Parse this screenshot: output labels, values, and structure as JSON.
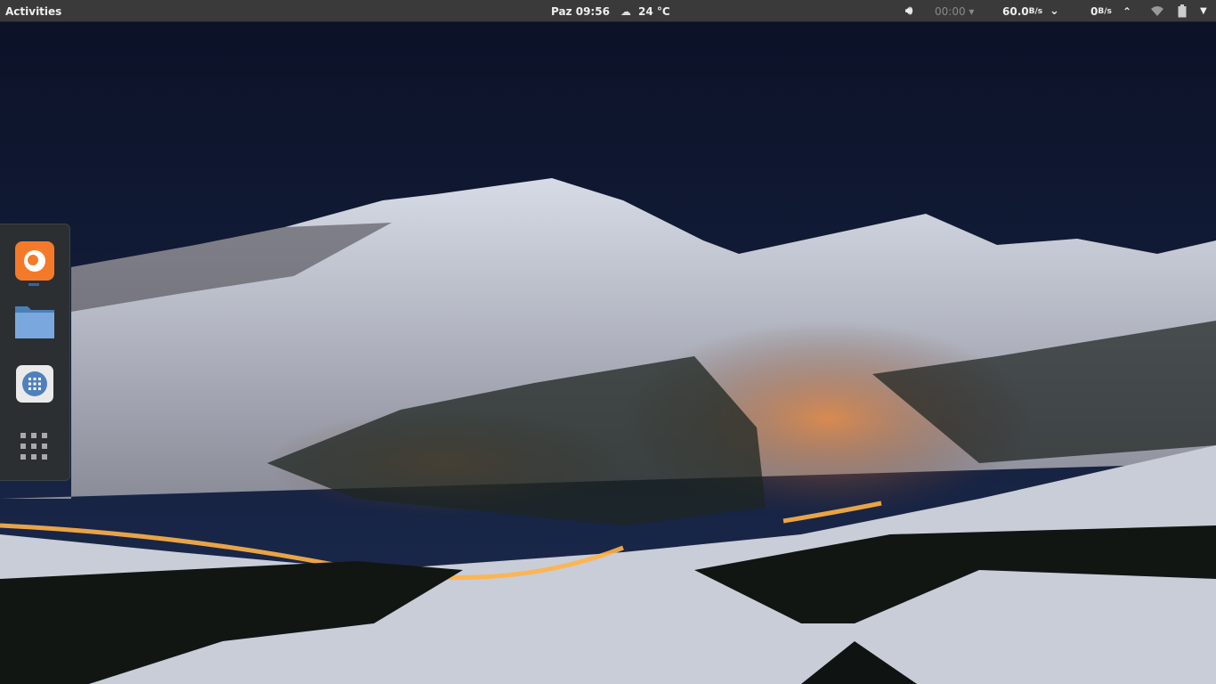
{
  "topbar": {
    "activities": "Activities",
    "clock": "Paz 09:56",
    "weather_icon": "cloud-icon",
    "temperature": "24 °C",
    "volume_icon": "speaker-icon",
    "media_time": "00:00",
    "net_down": "60.0",
    "net_down_unit": "B/s",
    "net_up": "0",
    "net_up_unit": "B/s",
    "wifi_icon": "wifi-icon",
    "battery_icon": "battery-icon"
  },
  "dock": {
    "items": [
      {
        "name": "Firefox",
        "icon": "firefox-icon",
        "running": true
      },
      {
        "name": "Files",
        "icon": "folder-icon"
      },
      {
        "name": "Software",
        "icon": "software-center-icon"
      },
      {
        "name": "Show Applications",
        "icon": "app-grid-icon"
      }
    ]
  },
  "colors": {
    "topbar": "#3a3a3a",
    "dock": "#2b2f31",
    "accent": "#3465a4",
    "firefox": "#f47a2a"
  }
}
